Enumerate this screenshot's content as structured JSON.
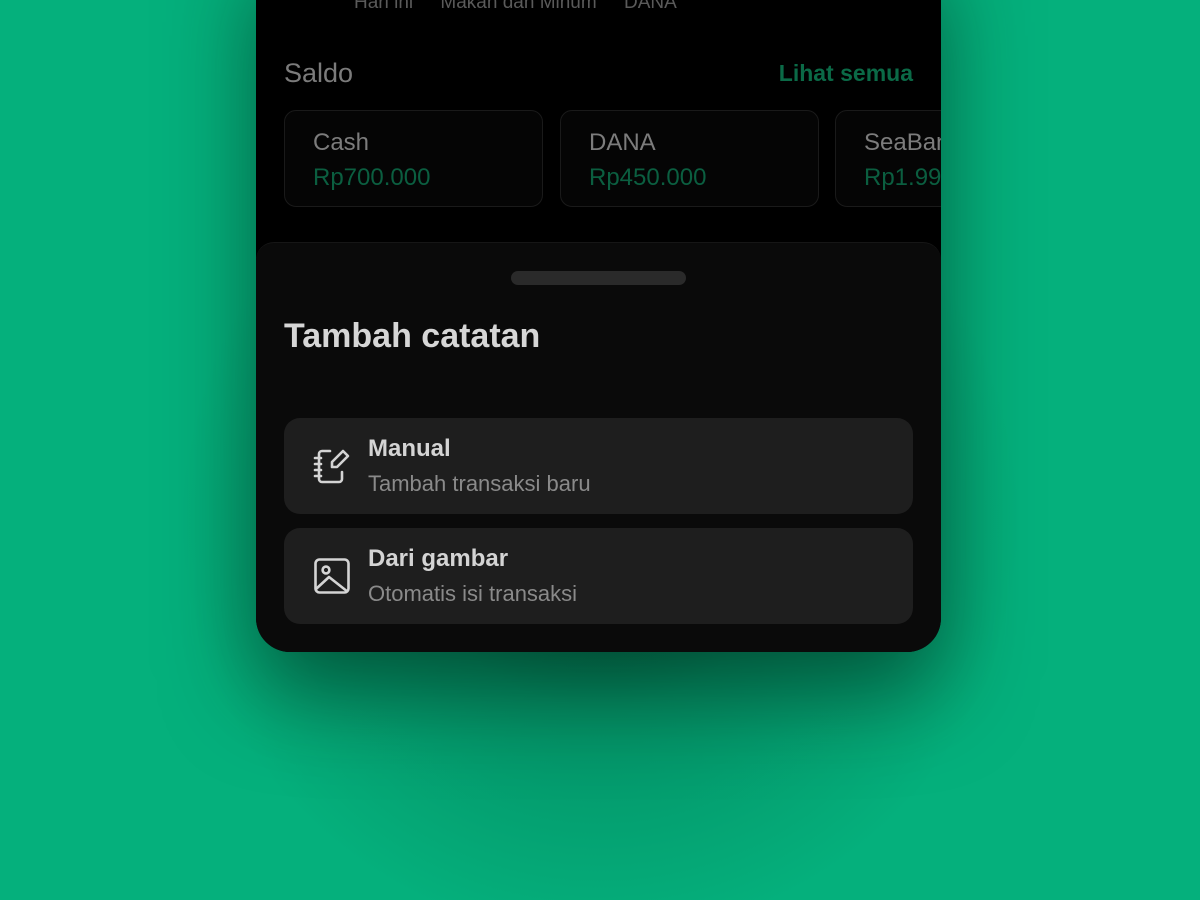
{
  "header": {
    "meta": [
      "Hari ini",
      "Makan dan Minum",
      "DANA"
    ]
  },
  "saldo": {
    "title": "Saldo",
    "see_all": "Lihat semua",
    "accounts": [
      {
        "name": "Cash",
        "amount": "Rp700.000"
      },
      {
        "name": "DANA",
        "amount": "Rp450.000"
      },
      {
        "name": "SeaBank",
        "amount": "Rp1.99"
      }
    ]
  },
  "sheet": {
    "title": "Tambah catatan",
    "options": [
      {
        "icon": "notebook-edit-icon",
        "label": "Manual",
        "description": "Tambah transaksi baru"
      },
      {
        "icon": "image-icon",
        "label": "Dari gambar",
        "description": "Otomatis isi transaksi"
      }
    ]
  },
  "colors": {
    "background": "#05b07c",
    "accent": "#0b6a47",
    "sheet": "#0a0a0a",
    "option_bg": "#1e1e1e"
  }
}
